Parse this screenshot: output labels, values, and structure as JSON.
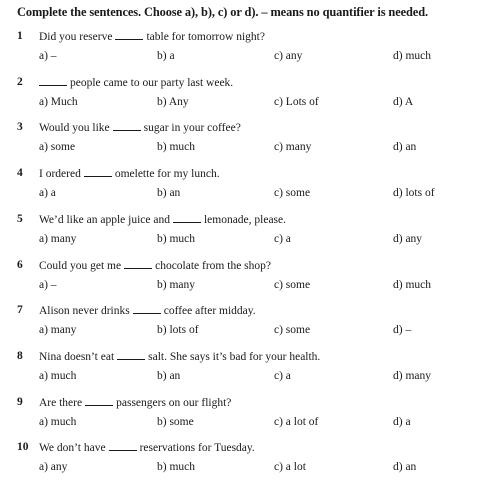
{
  "heading": "Complete the sentences. Choose a), b), c) or d). – means no quantifier is needed.",
  "questions": [
    {
      "number": "1",
      "before": "Did you reserve",
      "after": "table for tomorrow night?",
      "options": [
        "a) –",
        "b) a",
        "c) any",
        "d) much"
      ]
    },
    {
      "number": "2",
      "before": "",
      "after": "people came to our party last week.",
      "options": [
        "a) Much",
        "b) Any",
        "c) Lots of",
        "d) A"
      ]
    },
    {
      "number": "3",
      "before": "Would you like",
      "after": "sugar in your coffee?",
      "options": [
        "a) some",
        "b) much",
        "c) many",
        "d) an"
      ]
    },
    {
      "number": "4",
      "before": "I ordered",
      "after": "omelette for my lunch.",
      "options": [
        "a) a",
        "b) an",
        "c) some",
        "d) lots of"
      ]
    },
    {
      "number": "5",
      "before": "We’d like an apple juice and",
      "after": "lemonade, please.",
      "options": [
        "a) many",
        "b) much",
        "c) a",
        "d) any"
      ]
    },
    {
      "number": "6",
      "before": "Could you get me",
      "after": "chocolate from the shop?",
      "options": [
        "a) –",
        "b) many",
        "c) some",
        "d) much"
      ]
    },
    {
      "number": "7",
      "before": "Alison never drinks",
      "after": "coffee after midday.",
      "options": [
        "a) many",
        "b) lots of",
        "c) some",
        "d) –"
      ]
    },
    {
      "number": "8",
      "before": "Nina doesn’t eat",
      "after": "salt. She says it’s bad for your health.",
      "options": [
        "a) much",
        "b) an",
        "c) a",
        "d) many"
      ]
    },
    {
      "number": "9",
      "before": "Are there",
      "after": "passengers on our flight?",
      "options": [
        "a) much",
        "b) some",
        "c) a lot of",
        "d) a"
      ]
    },
    {
      "number": "10",
      "before": "We don’t have",
      "after": "reservations for Tuesday.",
      "options": [
        "a) any",
        "b) much",
        "c) a lot",
        "d) an"
      ]
    }
  ]
}
